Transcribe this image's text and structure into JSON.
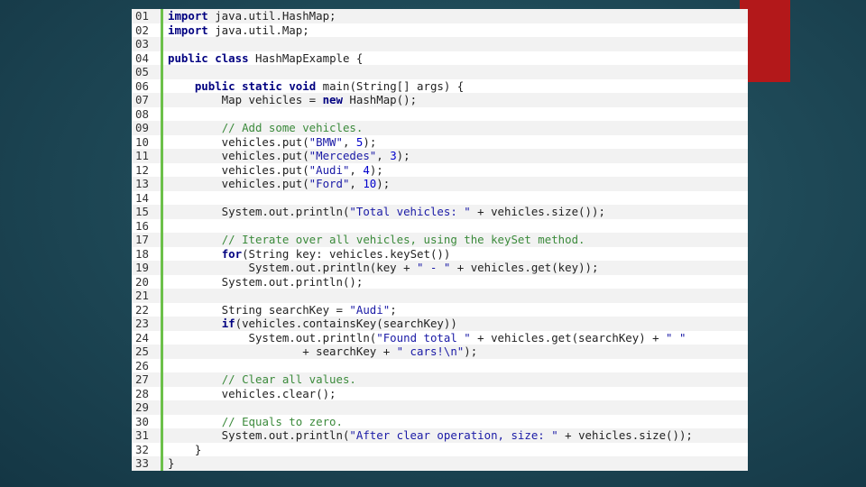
{
  "slide": {
    "accent_color": "#b3181a",
    "background_color": "#1f4a58"
  },
  "code": {
    "lines": [
      {
        "num": "01",
        "tokens": [
          [
            "kw",
            "import"
          ],
          [
            "plain",
            " java.util.HashMap;"
          ]
        ]
      },
      {
        "num": "02",
        "tokens": [
          [
            "kw",
            "import"
          ],
          [
            "plain",
            " java.util.Map;"
          ]
        ]
      },
      {
        "num": "03",
        "tokens": []
      },
      {
        "num": "04",
        "tokens": [
          [
            "kw",
            "public"
          ],
          [
            "plain",
            " "
          ],
          [
            "kw",
            "class"
          ],
          [
            "plain",
            " HashMapExample {"
          ]
        ]
      },
      {
        "num": "05",
        "tokens": []
      },
      {
        "num": "06",
        "tokens": [
          [
            "plain",
            "    "
          ],
          [
            "kw",
            "public"
          ],
          [
            "plain",
            " "
          ],
          [
            "kw",
            "static"
          ],
          [
            "plain",
            " "
          ],
          [
            "kw",
            "void"
          ],
          [
            "plain",
            " main(String[] args) {"
          ]
        ]
      },
      {
        "num": "07",
        "tokens": [
          [
            "plain",
            "        Map vehicles = "
          ],
          [
            "kw",
            "new"
          ],
          [
            "plain",
            " HashMap();"
          ]
        ]
      },
      {
        "num": "08",
        "tokens": []
      },
      {
        "num": "09",
        "tokens": [
          [
            "plain",
            "        "
          ],
          [
            "cmt",
            "// Add some vehicles."
          ]
        ]
      },
      {
        "num": "10",
        "tokens": [
          [
            "plain",
            "        vehicles.put("
          ],
          [
            "str",
            "\"BMW\""
          ],
          [
            "plain",
            ", "
          ],
          [
            "num",
            "5"
          ],
          [
            "plain",
            ");"
          ]
        ]
      },
      {
        "num": "11",
        "tokens": [
          [
            "plain",
            "        vehicles.put("
          ],
          [
            "str",
            "\"Mercedes\""
          ],
          [
            "plain",
            ", "
          ],
          [
            "num",
            "3"
          ],
          [
            "plain",
            ");"
          ]
        ]
      },
      {
        "num": "12",
        "tokens": [
          [
            "plain",
            "        vehicles.put("
          ],
          [
            "str",
            "\"Audi\""
          ],
          [
            "plain",
            ", "
          ],
          [
            "num",
            "4"
          ],
          [
            "plain",
            ");"
          ]
        ]
      },
      {
        "num": "13",
        "tokens": [
          [
            "plain",
            "        vehicles.put("
          ],
          [
            "str",
            "\"Ford\""
          ],
          [
            "plain",
            ", "
          ],
          [
            "num",
            "10"
          ],
          [
            "plain",
            ");"
          ]
        ]
      },
      {
        "num": "14",
        "tokens": []
      },
      {
        "num": "15",
        "tokens": [
          [
            "plain",
            "        System.out.println("
          ],
          [
            "str",
            "\"Total vehicles: \""
          ],
          [
            "plain",
            " + vehicles.size());"
          ]
        ]
      },
      {
        "num": "16",
        "tokens": []
      },
      {
        "num": "17",
        "tokens": [
          [
            "plain",
            "        "
          ],
          [
            "cmt",
            "// Iterate over all vehicles, using the keySet method."
          ]
        ]
      },
      {
        "num": "18",
        "tokens": [
          [
            "plain",
            "        "
          ],
          [
            "kw",
            "for"
          ],
          [
            "plain",
            "(String key: vehicles.keySet())"
          ]
        ]
      },
      {
        "num": "19",
        "tokens": [
          [
            "plain",
            "            System.out.println(key + "
          ],
          [
            "str",
            "\" - \""
          ],
          [
            "plain",
            " + vehicles.get(key));"
          ]
        ]
      },
      {
        "num": "20",
        "tokens": [
          [
            "plain",
            "        System.out.println();"
          ]
        ]
      },
      {
        "num": "21",
        "tokens": []
      },
      {
        "num": "22",
        "tokens": [
          [
            "plain",
            "        String searchKey = "
          ],
          [
            "str",
            "\"Audi\""
          ],
          [
            "plain",
            ";"
          ]
        ]
      },
      {
        "num": "23",
        "tokens": [
          [
            "plain",
            "        "
          ],
          [
            "kw",
            "if"
          ],
          [
            "plain",
            "(vehicles.containsKey(searchKey))"
          ]
        ]
      },
      {
        "num": "24",
        "tokens": [
          [
            "plain",
            "            System.out.println("
          ],
          [
            "str",
            "\"Found total \""
          ],
          [
            "plain",
            " + vehicles.get(searchKey) + "
          ],
          [
            "str",
            "\" \""
          ]
        ]
      },
      {
        "num": "25",
        "tokens": [
          [
            "plain",
            "                    + searchKey + "
          ],
          [
            "str",
            "\" cars!\\n\""
          ],
          [
            "plain",
            ");"
          ]
        ]
      },
      {
        "num": "26",
        "tokens": []
      },
      {
        "num": "27",
        "tokens": [
          [
            "plain",
            "        "
          ],
          [
            "cmt",
            "// Clear all values."
          ]
        ]
      },
      {
        "num": "28",
        "tokens": [
          [
            "plain",
            "        vehicles.clear();"
          ]
        ]
      },
      {
        "num": "29",
        "tokens": []
      },
      {
        "num": "30",
        "tokens": [
          [
            "plain",
            "        "
          ],
          [
            "cmt",
            "// Equals to zero."
          ]
        ]
      },
      {
        "num": "31",
        "tokens": [
          [
            "plain",
            "        System.out.println("
          ],
          [
            "str",
            "\"After clear operation, size: \""
          ],
          [
            "plain",
            " + vehicles.size());"
          ]
        ]
      },
      {
        "num": "32",
        "tokens": [
          [
            "plain",
            "    }"
          ]
        ]
      },
      {
        "num": "33",
        "tokens": [
          [
            "plain",
            "}"
          ]
        ]
      }
    ]
  }
}
